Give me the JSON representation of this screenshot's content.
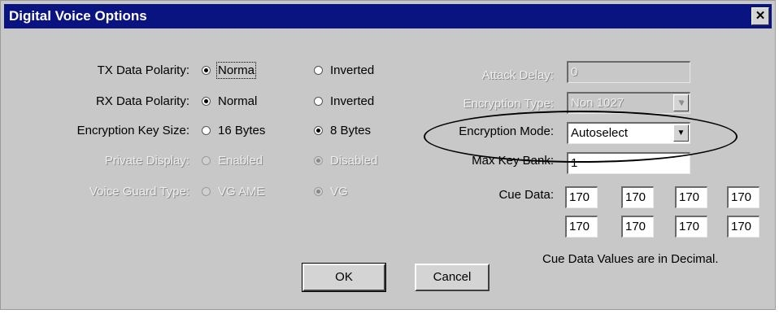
{
  "window": {
    "title": "Digital Voice Options",
    "close_glyph": "✕"
  },
  "left": {
    "tx": {
      "label": "TX Data Polarity:",
      "opt1": "Norma",
      "opt2": "Inverted",
      "selected": 1
    },
    "rx": {
      "label": "RX Data Polarity:",
      "opt1": "Normal",
      "opt2": "Inverted",
      "selected": 1
    },
    "keysize": {
      "label": "Encryption Key Size:",
      "opt1": "16 Bytes",
      "opt2": "8 Bytes",
      "selected": 2
    },
    "private": {
      "label": "Private Display:",
      "opt1": "Enabled",
      "opt2": "Disabled",
      "selected": 2,
      "disabled": true
    },
    "voiceguard": {
      "label": "Voice Guard Type:",
      "opt1": "VG AME",
      "opt2": "VG",
      "selected": 2,
      "disabled": true
    }
  },
  "right": {
    "attack_delay": {
      "label": "Attack Delay:",
      "value": "0",
      "disabled": true
    },
    "encryption_type": {
      "label": "Encryption Type:",
      "value": "Non 1027",
      "disabled": true
    },
    "encryption_mode": {
      "label": "Encryption Mode:",
      "value": "Autoselect"
    },
    "max_key_bank": {
      "label": "Max Key Bank:",
      "value": "1"
    },
    "cue_data": {
      "label": "Cue Data:",
      "row1": [
        "170",
        "170",
        "170",
        "170"
      ],
      "row2": [
        "170",
        "170",
        "170",
        "170"
      ],
      "note": "Cue Data Values are in Decimal."
    }
  },
  "buttons": {
    "ok": "OK",
    "cancel": "Cancel"
  },
  "colors": {
    "titlebar": "#0a1480",
    "dialog_bg": "#c8c8c8",
    "annotation_oval": "#000000"
  },
  "icons": {
    "dropdown": "▼"
  }
}
